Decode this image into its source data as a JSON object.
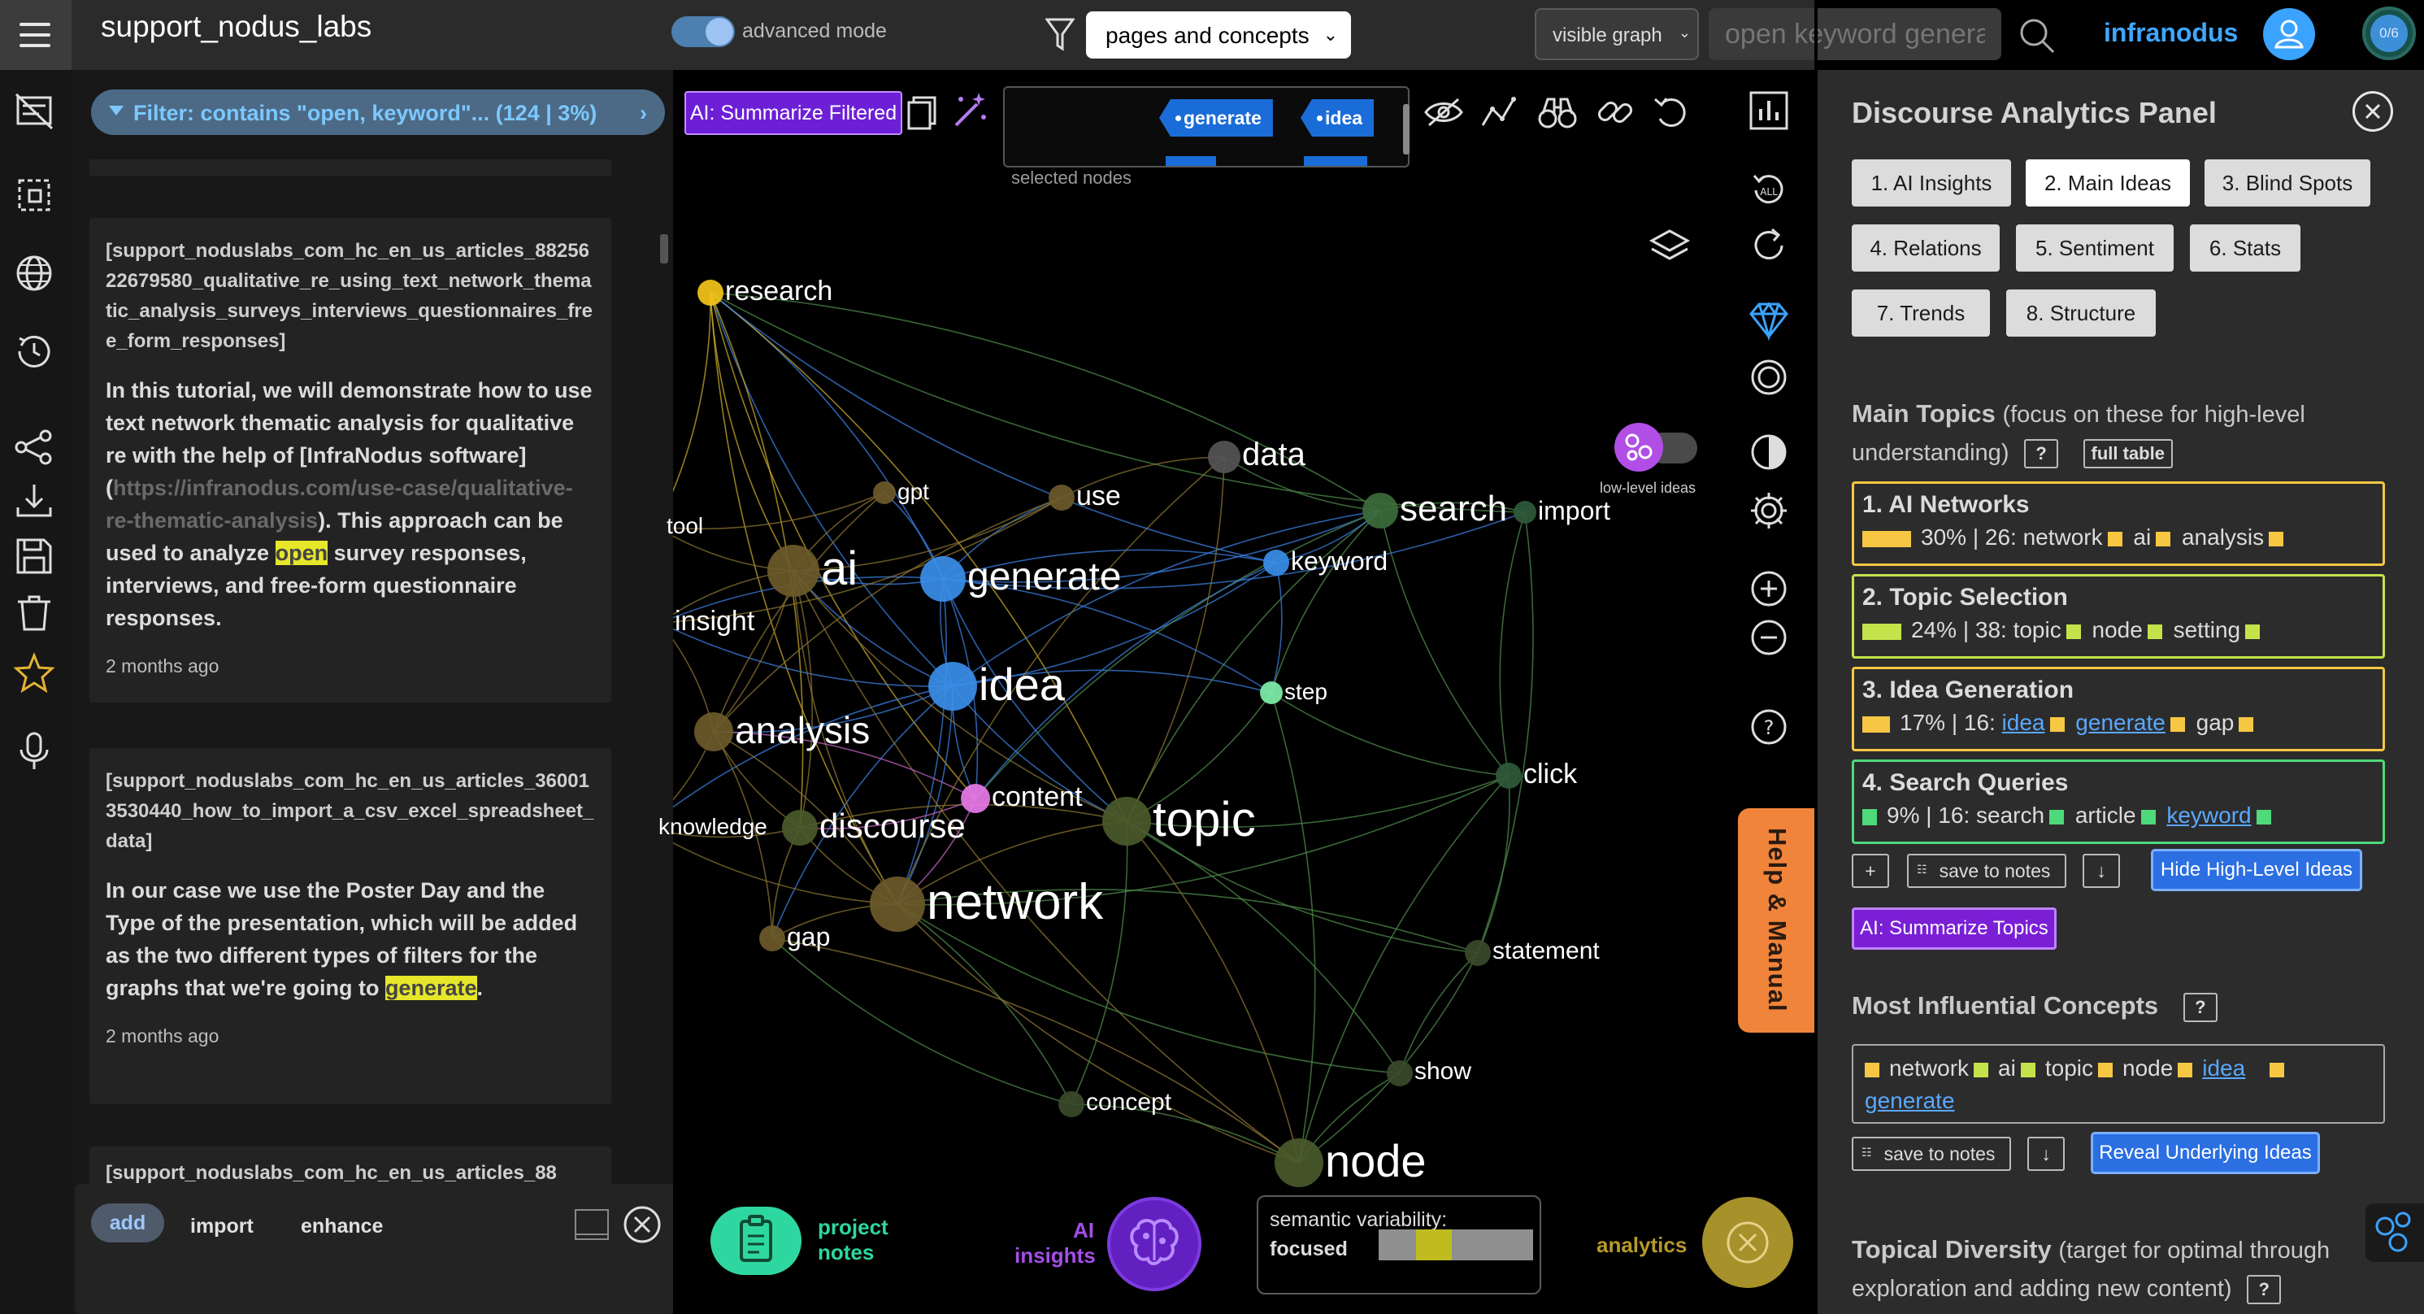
{
  "topbar": {
    "app_title": "support_nodus_labs",
    "advanced_mode_label": "advanced mode",
    "view_select": "pages and concepts",
    "graph_select": "visible graph",
    "search_placeholder": "open keyword genera",
    "brand": "infranodus",
    "counter": "0/6"
  },
  "filter": {
    "label": "Filter: contains \"open, keyword\"... (124 | 3%)"
  },
  "notes": [
    {
      "tag": "[support_noduslabs_com_hc_en_us_articles_8825622679580_qualitative_re_using_text_network_thematic_analysis_surveys_interviews_questionnaires_free_form_responses]",
      "body_a": "In this tutorial, we will demonstrate how to use text network thematic analysis for qualitative re with the help of [InfraNodus software](",
      "body_link": "https://infranodus.com/use-case/qualitative-re-thematic-analysis",
      "body_b": "). This approach can be used to analyze ",
      "body_hl": "open",
      "body_c": " survey responses, interviews, and free-form questionnaire responses.",
      "time": "2 months ago"
    },
    {
      "tag": "[support_noduslabs_com_hc_en_us_articles_360013530440_how_to_import_a_csv_excel_spreadsheet_data]",
      "body_a": "In our case we use the Poster Day and the Type of the presentation, which will be added as the two different types of filters for the graphs that we're going to ",
      "body_hl": "generate",
      "body_c": ".",
      "time": "2 months ago"
    },
    {
      "tag": "[support_noduslabs_com_hc_en_us_articles_88"
    }
  ],
  "add_panel": {
    "tabs": [
      "add",
      "import",
      "enhance"
    ]
  },
  "graph_toolbar": {
    "ai_summarize_filtered": "AI: Summarize Filtered",
    "selected_nodes": [
      "generate",
      "idea"
    ],
    "selected_nodes_label": "selected nodes",
    "low_level_label": "low-level ideas"
  },
  "graph": {
    "nodes": [
      {
        "label": "research",
        "color": "#f5c518"
      },
      {
        "label": "data",
        "color": "#555555"
      },
      {
        "label": "search",
        "color": "#3c6b3c"
      },
      {
        "label": "import",
        "color": "#2f5a3a"
      },
      {
        "label": "tool",
        "color": "#6b5a2a"
      },
      {
        "label": "gpt",
        "color": "#6b5a2a"
      },
      {
        "label": "use",
        "color": "#6b5a2a"
      },
      {
        "label": "ai",
        "color": "#6b5a2a"
      },
      {
        "label": "generate",
        "color": "#3a8ee8"
      },
      {
        "label": "keyword",
        "color": "#3a8ee8"
      },
      {
        "label": "insight",
        "color": "#6b5a2a"
      },
      {
        "label": "idea",
        "color": "#3a8ee8"
      },
      {
        "label": "step",
        "color": "#7ef0a8"
      },
      {
        "label": "analysis",
        "color": "#6b5a2a"
      },
      {
        "label": "content",
        "color": "#e87ae8"
      },
      {
        "label": "click",
        "color": "#2f5a3a"
      },
      {
        "label": "knowledge",
        "color": "#6b5a2a"
      },
      {
        "label": "discourse",
        "color": "#4a5a2a"
      },
      {
        "label": "topic",
        "color": "#4a5a2a"
      },
      {
        "label": "network",
        "color": "#6b5a2a"
      },
      {
        "label": "gap",
        "color": "#6b5a2a"
      },
      {
        "label": "statement",
        "color": "#3a4a2a"
      },
      {
        "label": "show",
        "color": "#3a4a2a"
      },
      {
        "label": "concept",
        "color": "#3a4a2a"
      },
      {
        "label": "node",
        "color": "#4a5a2a"
      }
    ]
  },
  "help_manual": "Help & Manual",
  "bottom": {
    "project_notes": "project notes",
    "ai_insights": "AI insights",
    "semantic_label": "semantic variability:",
    "semantic_value": "focused",
    "analytics": "analytics"
  },
  "panel": {
    "title": "Discourse Analytics Panel",
    "tabs": [
      "1. AI Insights",
      "2. Main Ideas",
      "3. Blind Spots",
      "4. Relations",
      "5. Sentiment",
      "6. Stats",
      "7. Trends",
      "8. Structure"
    ],
    "main_topics": {
      "heading": "Main Topics",
      "sub": "(focus on these for high-level understanding)",
      "help": "?",
      "full_table": "full table",
      "topics": [
        {
          "title": "1. AI Networks",
          "stats": "30% | 26:",
          "words": [
            "network",
            "ai",
            "analysis"
          ],
          "percent": 30,
          "color": "#f7c744"
        },
        {
          "title": "2. Topic Selection",
          "stats": "24% | 38:",
          "words": [
            "topic",
            "node",
            "setting"
          ],
          "percent": 24,
          "color": "#c4e34a"
        },
        {
          "title": "3. Idea Generation",
          "stats": "17% | 16:",
          "words": [
            "idea",
            "generate",
            "gap"
          ],
          "percent": 17,
          "color": "#f7c744"
        },
        {
          "title": "4. Search Queries",
          "stats": "9% | 16:",
          "words": [
            "search",
            "article",
            "keyword"
          ],
          "percent": 9,
          "color": "#4ed97a"
        }
      ],
      "plus": "+",
      "save_to_notes": "save to notes",
      "down": "↓",
      "hide_btn": "Hide High-Level Ideas",
      "ai_summarize": "AI: Summarize Topics"
    },
    "influential": {
      "heading": "Most Influential Concepts",
      "help": "?",
      "concepts": [
        "network",
        "ai",
        "topic",
        "node",
        "idea",
        "generate"
      ],
      "save_to_notes": "save to notes",
      "down": "↓",
      "reveal_btn": "Reveal Underlying Ideas"
    },
    "diversity": {
      "heading": "Topical Diversity",
      "sub": "(target for optimal through exploration and adding new content)",
      "help": "?"
    }
  }
}
